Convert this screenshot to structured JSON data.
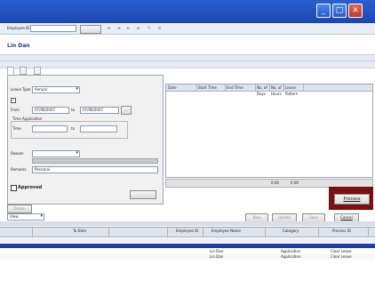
{
  "window": {
    "title": "",
    "controls": {
      "minimize": "_",
      "maximize": "□",
      "close": "✕"
    }
  },
  "toolbar": {
    "employee_id_label": "Employee ID",
    "employee_id_value": "",
    "search_label": "",
    "employee_name": "Lin Dan"
  },
  "bands": {
    "top": "",
    "detail": ""
  },
  "tabs": [
    {
      "label": ""
    },
    {
      "label": ""
    },
    {
      "label": ""
    }
  ],
  "form": {
    "leave_type_label": "Leave Type",
    "leave_type_value": "Annual",
    "multi_application_label": "",
    "from_label": "From",
    "from_value": "07/09/2007",
    "to_label": "to",
    "to_value": "07/09/2007",
    "time_application_label": "Time Application",
    "time_label": "Time",
    "time_from_value": "",
    "time_to_label": "to",
    "time_to_value": "",
    "reason_label": "Reason",
    "reason_value": "",
    "remarks_label": "Remarks",
    "remarks_value": "Personal",
    "approved_label": "Approved",
    "delete_label": "Delete",
    "clear_label": ""
  },
  "records": {
    "title": "",
    "columns": [
      "Date",
      "Start Time",
      "End Time",
      "No. of Days",
      "No. of Hours",
      "Leave Pattern"
    ],
    "status_label": "0.00",
    "status_value": "0.00"
  },
  "actions": {
    "process_label": "Process",
    "new_label": "New",
    "update_label": "Update",
    "save_label": "Save",
    "cancel_label": "Cancel"
  },
  "filter": {
    "view_label": "View",
    "value": ""
  },
  "grid": {
    "columns": [
      "",
      "To Date",
      "",
      "Employee ID",
      "Employee Name",
      "Category",
      "Process ID"
    ],
    "group_header": "",
    "rows": [
      [
        "",
        "",
        "",
        "",
        "",
        "",
        ""
      ],
      [
        "",
        "",
        "",
        "",
        "Lin Dan",
        "Application",
        "Clear Leave"
      ],
      [
        "",
        "",
        "",
        "",
        "Lin Dan",
        "Application",
        "Clear Leave"
      ]
    ]
  }
}
